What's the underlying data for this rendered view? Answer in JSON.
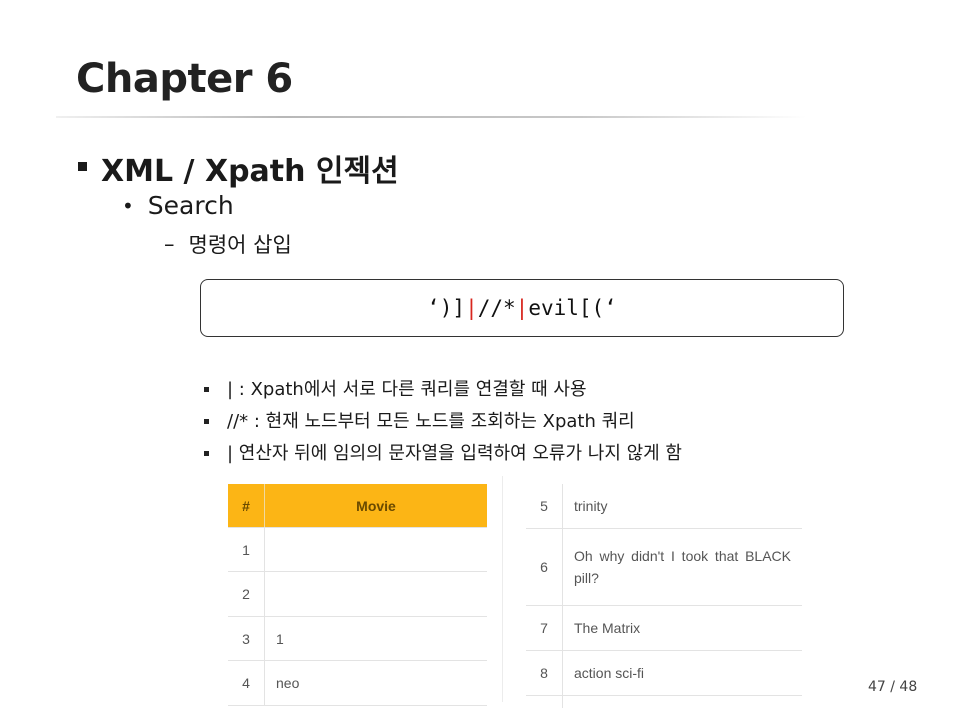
{
  "slide": {
    "title": "Chapter 6",
    "heading": "XML / Xpath 인젝션",
    "sub": "Search",
    "subsub": "명령어 삽입"
  },
  "code": {
    "part1": "‘)]",
    "pipe1": "|",
    "part2": "//*",
    "pipe2": "|",
    "part3": "evil[(‘"
  },
  "bullets": [
    "| : Xpath에서 서로 다른 쿼리를 연결할 때 사용",
    "//* : 현재 노드부터 모든 노드를 조회하는 Xpath 쿼리",
    "| 연산자 뒤에 임의의 문자열을 입력하여 오류가 나지 않게 함"
  ],
  "table_left": {
    "headers": [
      "#",
      "Movie"
    ],
    "rows": [
      [
        "1",
        ""
      ],
      [
        "2",
        ""
      ],
      [
        "3",
        "1"
      ],
      [
        "4",
        "neo"
      ]
    ]
  },
  "table_right": {
    "rows": [
      [
        "5",
        "trinity"
      ],
      [
        "6",
        "Oh why didn't I took that BLACK pill?"
      ],
      [
        "7",
        "The Matrix"
      ],
      [
        "8",
        "action sci-fi"
      ]
    ]
  },
  "page": "47 / 48",
  "colors": {
    "header_bg": "#fcb515",
    "pipe": "#d8261e"
  }
}
